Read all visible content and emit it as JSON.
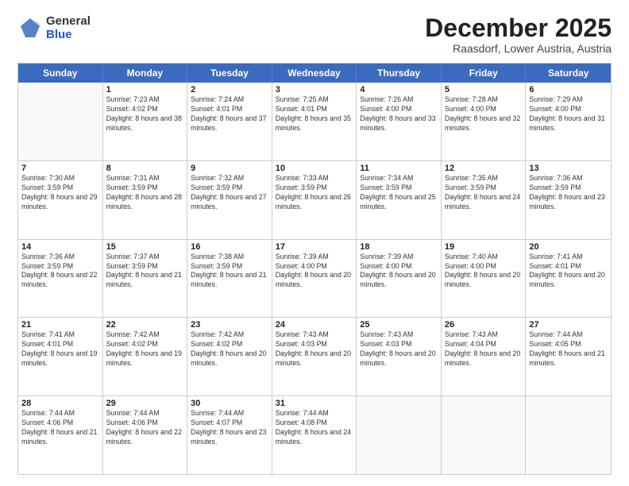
{
  "logo": {
    "general": "General",
    "blue": "Blue"
  },
  "title": "December 2025",
  "location": "Raasdorf, Lower Austria, Austria",
  "days_of_week": [
    "Sunday",
    "Monday",
    "Tuesday",
    "Wednesday",
    "Thursday",
    "Friday",
    "Saturday"
  ],
  "weeks": [
    [
      {
        "day": "",
        "empty": true
      },
      {
        "day": "1",
        "sunrise": "7:23 AM",
        "sunset": "4:02 PM",
        "daylight": "8 hours and 38 minutes."
      },
      {
        "day": "2",
        "sunrise": "7:24 AM",
        "sunset": "4:01 PM",
        "daylight": "8 hours and 37 minutes."
      },
      {
        "day": "3",
        "sunrise": "7:25 AM",
        "sunset": "4:01 PM",
        "daylight": "8 hours and 35 minutes."
      },
      {
        "day": "4",
        "sunrise": "7:26 AM",
        "sunset": "4:00 PM",
        "daylight": "8 hours and 33 minutes."
      },
      {
        "day": "5",
        "sunrise": "7:28 AM",
        "sunset": "4:00 PM",
        "daylight": "8 hours and 32 minutes."
      },
      {
        "day": "6",
        "sunrise": "7:29 AM",
        "sunset": "4:00 PM",
        "daylight": "8 hours and 31 minutes."
      }
    ],
    [
      {
        "day": "7",
        "sunrise": "7:30 AM",
        "sunset": "3:59 PM",
        "daylight": "8 hours and 29 minutes."
      },
      {
        "day": "8",
        "sunrise": "7:31 AM",
        "sunset": "3:59 PM",
        "daylight": "8 hours and 28 minutes."
      },
      {
        "day": "9",
        "sunrise": "7:32 AM",
        "sunset": "3:59 PM",
        "daylight": "8 hours and 27 minutes."
      },
      {
        "day": "10",
        "sunrise": "7:33 AM",
        "sunset": "3:59 PM",
        "daylight": "8 hours and 26 minutes."
      },
      {
        "day": "11",
        "sunrise": "7:34 AM",
        "sunset": "3:59 PM",
        "daylight": "8 hours and 25 minutes."
      },
      {
        "day": "12",
        "sunrise": "7:35 AM",
        "sunset": "3:59 PM",
        "daylight": "8 hours and 24 minutes."
      },
      {
        "day": "13",
        "sunrise": "7:36 AM",
        "sunset": "3:59 PM",
        "daylight": "8 hours and 23 minutes."
      }
    ],
    [
      {
        "day": "14",
        "sunrise": "7:36 AM",
        "sunset": "3:59 PM",
        "daylight": "8 hours and 22 minutes."
      },
      {
        "day": "15",
        "sunrise": "7:37 AM",
        "sunset": "3:59 PM",
        "daylight": "8 hours and 21 minutes."
      },
      {
        "day": "16",
        "sunrise": "7:38 AM",
        "sunset": "3:59 PM",
        "daylight": "8 hours and 21 minutes."
      },
      {
        "day": "17",
        "sunrise": "7:39 AM",
        "sunset": "4:00 PM",
        "daylight": "8 hours and 20 minutes."
      },
      {
        "day": "18",
        "sunrise": "7:39 AM",
        "sunset": "4:00 PM",
        "daylight": "8 hours and 20 minutes."
      },
      {
        "day": "19",
        "sunrise": "7:40 AM",
        "sunset": "4:00 PM",
        "daylight": "8 hours and 20 minutes."
      },
      {
        "day": "20",
        "sunrise": "7:41 AM",
        "sunset": "4:01 PM",
        "daylight": "8 hours and 20 minutes."
      }
    ],
    [
      {
        "day": "21",
        "sunrise": "7:41 AM",
        "sunset": "4:01 PM",
        "daylight": "8 hours and 19 minutes."
      },
      {
        "day": "22",
        "sunrise": "7:42 AM",
        "sunset": "4:02 PM",
        "daylight": "8 hours and 19 minutes."
      },
      {
        "day": "23",
        "sunrise": "7:42 AM",
        "sunset": "4:02 PM",
        "daylight": "8 hours and 20 minutes."
      },
      {
        "day": "24",
        "sunrise": "7:43 AM",
        "sunset": "4:03 PM",
        "daylight": "8 hours and 20 minutes."
      },
      {
        "day": "25",
        "sunrise": "7:43 AM",
        "sunset": "4:03 PM",
        "daylight": "8 hours and 20 minutes."
      },
      {
        "day": "26",
        "sunrise": "7:43 AM",
        "sunset": "4:04 PM",
        "daylight": "8 hours and 20 minutes."
      },
      {
        "day": "27",
        "sunrise": "7:44 AM",
        "sunset": "4:05 PM",
        "daylight": "8 hours and 21 minutes."
      }
    ],
    [
      {
        "day": "28",
        "sunrise": "7:44 AM",
        "sunset": "4:06 PM",
        "daylight": "8 hours and 21 minutes."
      },
      {
        "day": "29",
        "sunrise": "7:44 AM",
        "sunset": "4:06 PM",
        "daylight": "8 hours and 22 minutes."
      },
      {
        "day": "30",
        "sunrise": "7:44 AM",
        "sunset": "4:07 PM",
        "daylight": "8 hours and 23 minutes."
      },
      {
        "day": "31",
        "sunrise": "7:44 AM",
        "sunset": "4:08 PM",
        "daylight": "8 hours and 24 minutes."
      },
      {
        "day": "",
        "empty": true
      },
      {
        "day": "",
        "empty": true
      },
      {
        "day": "",
        "empty": true
      }
    ]
  ]
}
